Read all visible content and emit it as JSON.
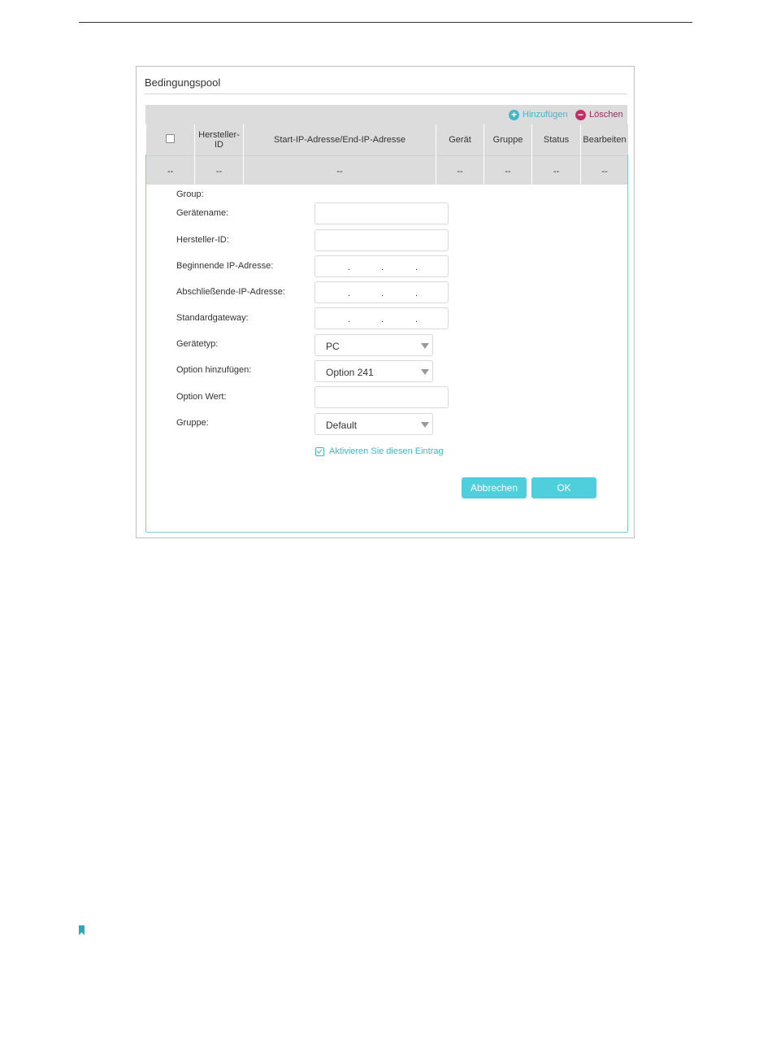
{
  "panel": {
    "title": "Bedingungspool"
  },
  "toolbar": {
    "add_label": "Hinzufügen",
    "delete_label": "Löschen",
    "add_icon": "plus-circle-icon",
    "delete_icon": "minus-circle-icon"
  },
  "table": {
    "headers": [
      "",
      "Hersteller-ID",
      "Start-IP-Adresse/End-IP-Adresse",
      "Gerät",
      "Gruppe",
      "Status",
      "Bearbeiten"
    ],
    "rows": [
      [
        "--",
        "--",
        "--",
        "--",
        "--",
        "--",
        "--"
      ]
    ]
  },
  "form": {
    "group_label": "Group:",
    "device_name_label": "Gerätename:",
    "device_name_value": "",
    "vendor_id_label": "Hersteller-ID:",
    "vendor_id_value": "",
    "start_ip_label": "Beginnende IP-Adresse:",
    "end_ip_label": "Abschließende-IP-Adresse:",
    "gateway_label": "Standardgateway:",
    "device_type_label": "Gerätetyp:",
    "device_type_value": "PC",
    "add_option_label": "Option hinzufügen:",
    "add_option_value": "Option 241",
    "option_value_label": "Option Wert:",
    "option_value_value": "",
    "group_select_label": "Gruppe:",
    "group_select_value": "Default",
    "enable_label": "Aktivieren Sie diesen Eintrag",
    "enable_checked": true
  },
  "buttons": {
    "cancel": "Abbrechen",
    "ok": "OK"
  },
  "colors": {
    "accent": "#4ecfdb",
    "delete": "#c22c68",
    "link": "#44b6c8"
  }
}
